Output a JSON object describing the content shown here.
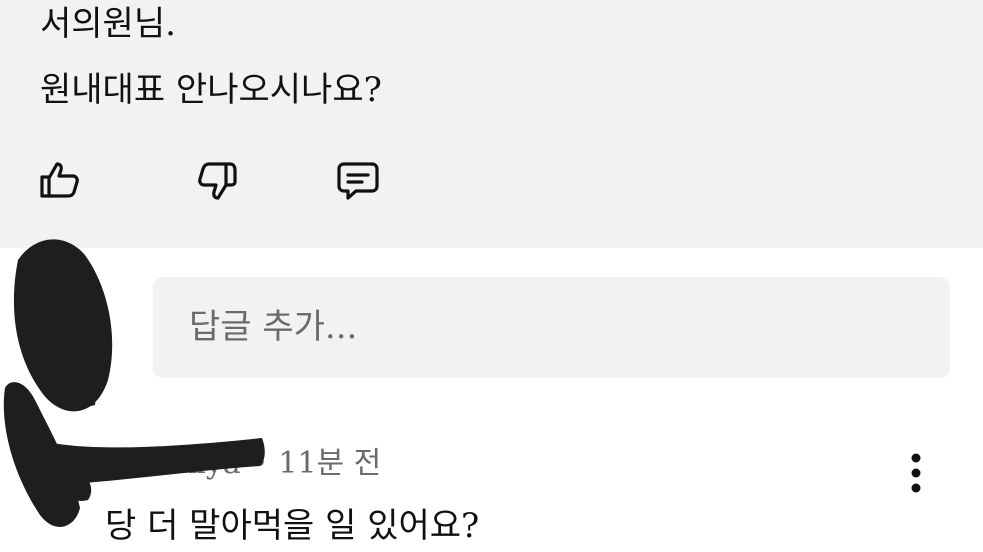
{
  "top_comment": {
    "lines": [
      "서의원님.",
      "원내대표 안나오시나요?"
    ]
  },
  "icons": {
    "like": "thumbs-up-icon",
    "dislike": "thumbs-down-icon",
    "reply": "comment-icon",
    "more": "more-vertical-icon"
  },
  "reply_input": {
    "placeholder": "답글 추가..."
  },
  "second_comment": {
    "author": "okiya",
    "separator": "•",
    "time": "11분 전",
    "text": "당 더 말아먹을 일 있어요?"
  },
  "colors": {
    "panel_bg": "#f2f2f2",
    "text": "#111111",
    "muted": "#6b6b6b",
    "redaction": "#1e1e1e"
  }
}
